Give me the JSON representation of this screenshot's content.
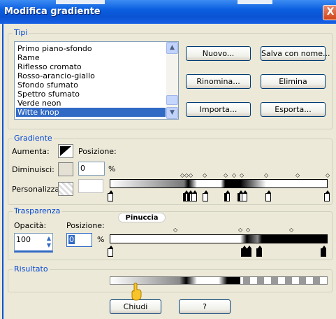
{
  "window": {
    "title": "Modifica gradiente",
    "close_label": "X"
  },
  "tipi": {
    "legend": "Tipi",
    "items": [
      "Primo piano-sfondo",
      "Rame",
      "Riflesso cromato",
      "Rosso-arancio-giallo",
      "Sfondo sfumato",
      "Spettro sfumato",
      "Verde neon",
      "Witte knop"
    ],
    "selected_index": 7,
    "buttons": {
      "nuovo": "Nuovo...",
      "salva": "Salva con nome...",
      "rinomina": "Rinomina...",
      "elimina": "Elimina",
      "importa": "Importa...",
      "esporta": "Esporta..."
    }
  },
  "gradiente": {
    "legend": "Gradiente",
    "aumenta_label": "Aumenta:",
    "posizione_label": "Posizione:",
    "diminuisci_label": "Diminuisci:",
    "posizione_value": "0",
    "percent": "%",
    "personalizza_label": "Personalizza:"
  },
  "trasparenza": {
    "legend": "Trasparenza",
    "opacita_label": "Opacità:",
    "opacita_value": "100",
    "posizione_label": "Posizione:",
    "posizione_value": "0",
    "percent": "%"
  },
  "watermark": "Pinuccia",
  "risultato": {
    "legend": "Risultato"
  },
  "footer": {
    "chiudi": "Chiudi",
    "help": "?"
  },
  "colors": {
    "title_bar": "#0a53d3",
    "legend_text": "#0046d5",
    "selection": "#316ac5"
  }
}
